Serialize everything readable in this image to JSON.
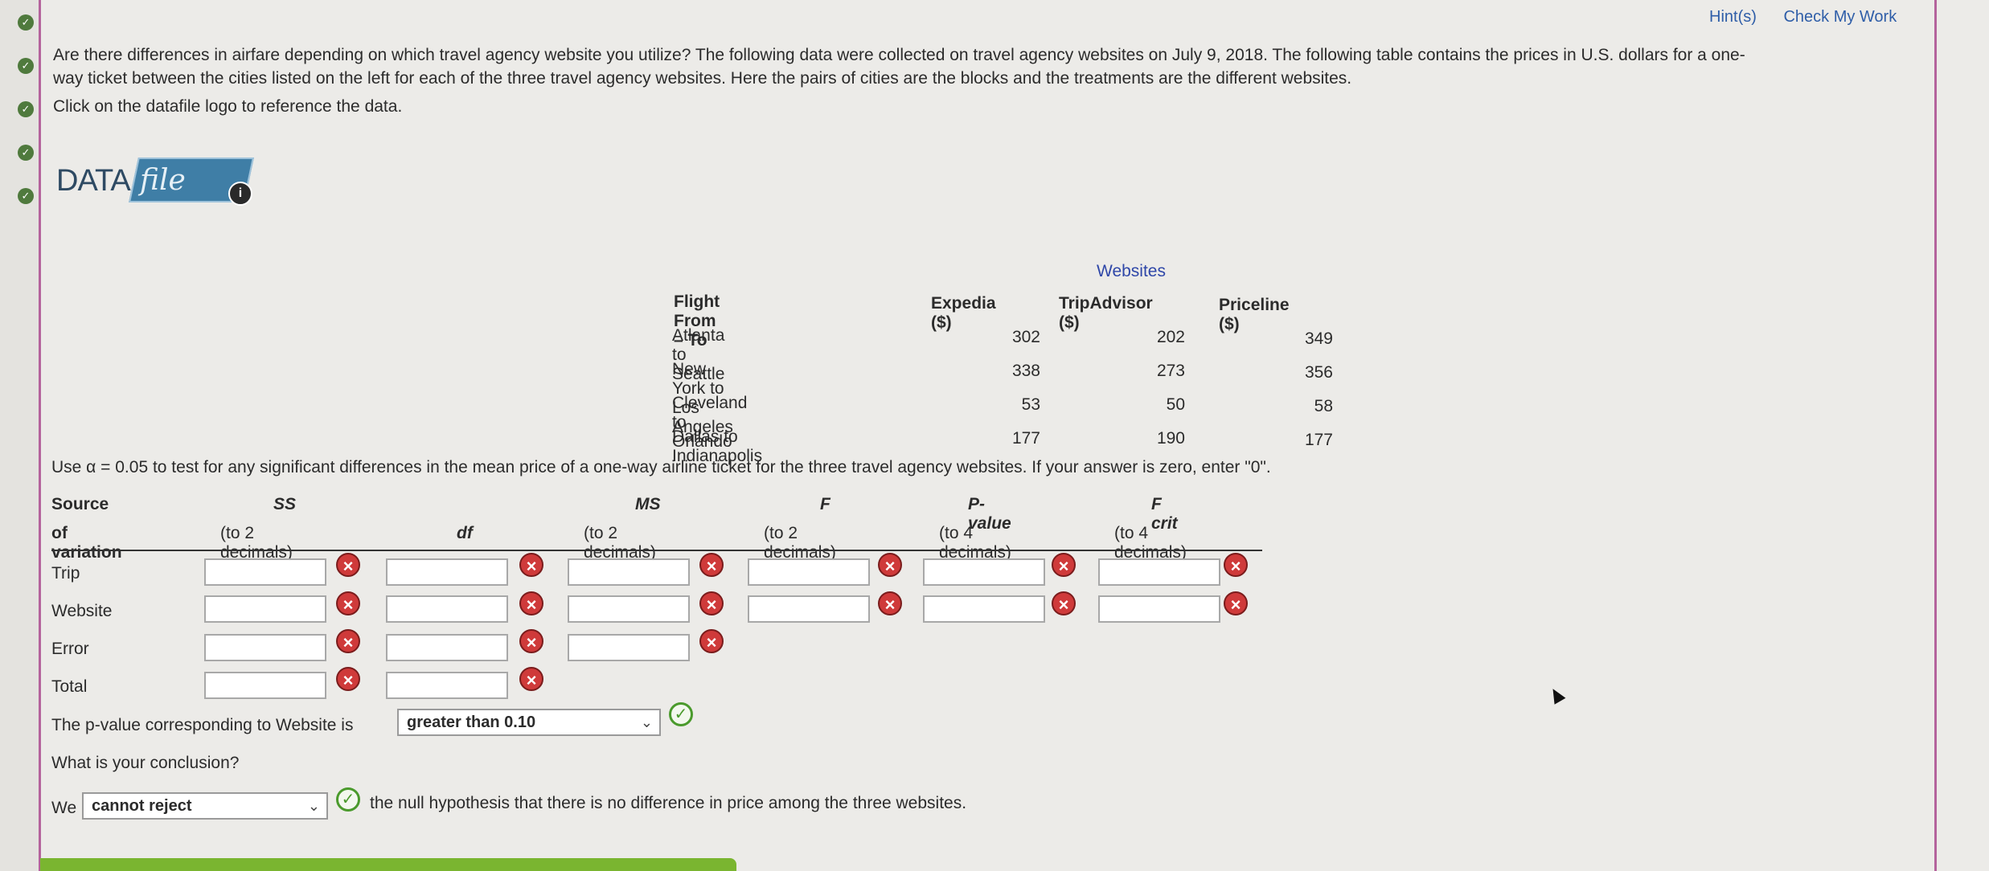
{
  "header": {
    "hints": "Hint(s)",
    "check_work": "Check My Work"
  },
  "intro": {
    "line1": "Are there differences in airfare depending on which travel agency website you utilize? The following data were collected on travel agency websites on July 9, 2018. The following table contains the prices in U.S. dollars for a one-",
    "line2": "way ticket between the cities listed on the left for each of the three travel agency websites. Here the pairs of cities are the blocks and the treatments are the different websites.",
    "line3": "Click on the datafile logo to reference the data."
  },
  "datafile": {
    "data": "DATA",
    "file": "file",
    "info": "i"
  },
  "flight_table": {
    "websites_label": "Websites",
    "col_flight": "Flight From – To",
    "col_expedia": "Expedia ($)",
    "col_tripadvisor": "TripAdvisor ($)",
    "col_priceline": "Priceline ($)",
    "rows": [
      {
        "route": "Atlanta to Seattle",
        "expedia": "302",
        "tripadvisor": "202",
        "priceline": "349"
      },
      {
        "route": "New York to Los Angeles",
        "expedia": "338",
        "tripadvisor": "273",
        "priceline": "356"
      },
      {
        "route": "Cleveland to Orlando",
        "expedia": "53",
        "tripadvisor": "50",
        "priceline": "58"
      },
      {
        "route": "Dallas to Indianapolis",
        "expedia": "177",
        "tripadvisor": "190",
        "priceline": "177"
      }
    ]
  },
  "use_alpha": "Use α = 0.05 to test for any significant differences in the mean price of a one-way airline ticket for the three travel agency websites. If your answer is zero, enter \"0\".",
  "anova": {
    "h_source": "Source",
    "h_source2": "of variation",
    "h_ss": "SS",
    "h_ss2": "(to 2 decimals)",
    "h_df": "df",
    "h_ms": "MS",
    "h_ms2": "(to 2 decimals)",
    "h_f": "F",
    "h_f2": "(to 2 decimals)",
    "h_p": "P-value",
    "h_p2": "(to 4 decimals)",
    "h_fcrit": "F crit",
    "h_fcrit2": "(to 4 decimals)",
    "rows": [
      "Trip",
      "Website",
      "Error",
      "Total"
    ],
    "incorrect_icon": "×"
  },
  "pvalue": {
    "prefix": "The p-value corresponding to Website is",
    "selected": "greater than 0.10",
    "status": "correct"
  },
  "conclusion": {
    "question": "What is your conclusion?",
    "prefix": "We",
    "selected": "cannot reject",
    "suffix": "the null hypothesis that there is no difference in price among the three websites.",
    "status": "correct"
  },
  "colors": {
    "accent_border": "#b4639c",
    "link": "#2f5ea8",
    "incorrect": "#cf3a3a",
    "correct": "#4a9a2c"
  }
}
